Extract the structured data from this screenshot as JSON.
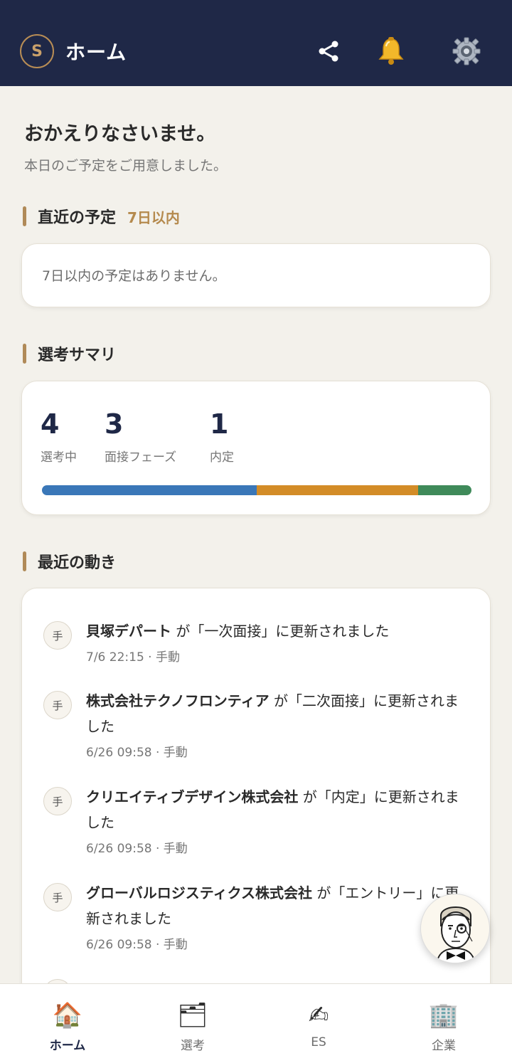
{
  "header": {
    "avatar_letter": "S",
    "title": "ホーム",
    "icons": [
      "share-icon",
      "bell-icon",
      "gear-icon"
    ]
  },
  "welcome": {
    "title": "おかえりなさいませ。",
    "subtitle": "本日のご予定をご用意しました。"
  },
  "upcoming": {
    "title": "直近の予定",
    "tag": "7日以内",
    "empty_text": "7日以内の予定はありません。"
  },
  "summary": {
    "title": "選考サマリ",
    "stats": [
      {
        "value": "4",
        "label": "選考中"
      },
      {
        "value": "3",
        "label": "面接フェーズ"
      },
      {
        "value": "1",
        "label": "内定"
      }
    ],
    "bar_colors": [
      "#3a77b8",
      "#d38c27",
      "#3f8a5a"
    ]
  },
  "activity": {
    "title": "最近の動き",
    "items": [
      {
        "badge": "手",
        "company": "貝塚デパート",
        "text": " が「一次面接」に更新されました",
        "meta": "7/6 22:15 · 手動"
      },
      {
        "badge": "手",
        "company": "株式会社テクノフロンティア",
        "text": " が「二次面接」に更新されました",
        "meta": "6/26 09:58 · 手動"
      },
      {
        "badge": "手",
        "company": "クリエイティブデザイン株式会社",
        "text": " が「内定」に更新されました",
        "meta": "6/26 09:58 · 手動"
      },
      {
        "badge": "手",
        "company": "グローバルロジスティクス株式会社",
        "text": " が「エントリー」に更新されました",
        "meta": "6/26 09:58 · 手動"
      }
    ]
  },
  "nav": {
    "items": [
      {
        "label": "ホーム",
        "icon": "house-icon",
        "glyph": "🏠",
        "active": true
      },
      {
        "label": "選考",
        "icon": "boxes-icon",
        "glyph": "🗂",
        "active": false
      },
      {
        "label": "ES",
        "icon": "writing-hand-icon",
        "glyph": "✍",
        "active": false
      },
      {
        "label": "企業",
        "icon": "office-building-icon",
        "glyph": "🏢",
        "active": false
      }
    ]
  }
}
